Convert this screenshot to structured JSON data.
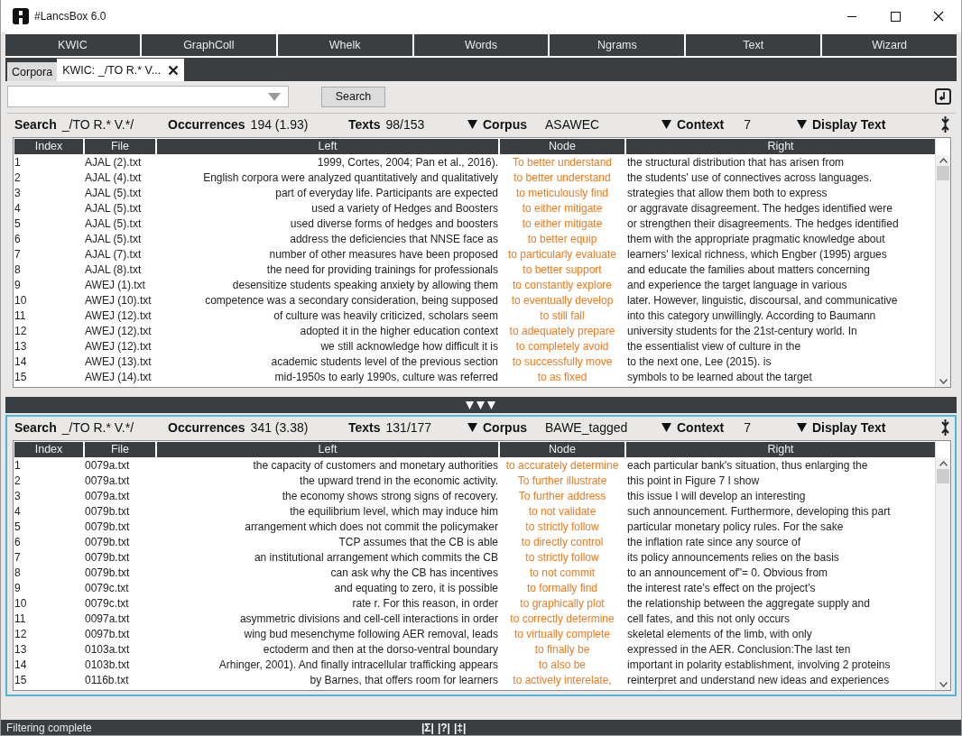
{
  "window": {
    "title": "#LancsBox 6.0"
  },
  "modules": [
    {
      "label": "KWIC"
    },
    {
      "label": "GraphColl"
    },
    {
      "label": "Whelk"
    },
    {
      "label": "Words"
    },
    {
      "label": "Ngrams"
    },
    {
      "label": "Text"
    },
    {
      "label": "Wizard"
    }
  ],
  "doc_tabs": [
    {
      "label": "Corpora",
      "selected": false,
      "closable": false
    },
    {
      "label": "KWIC:  _/TO R.* V...",
      "selected": true,
      "closable": true
    }
  ],
  "search_bar": {
    "button": "Search"
  },
  "panels": [
    {
      "active": false,
      "search_label": "Search",
      "search": "_/TO R.* V.*/",
      "occurrences_label": "Occurrences",
      "occurrences": "194 (1.93)",
      "texts_label": "Texts",
      "texts": "98/153",
      "corpus_label": "Corpus",
      "corpus": "ASAWEC",
      "context_label": "Context",
      "context": "7",
      "display_label": "Display Text",
      "columns": [
        "Index",
        "File",
        "Left",
        "Node",
        "Right"
      ],
      "rows": [
        [
          "1",
          "AJAL (2).txt",
          "1999, Cortes, 2004; Pan et al., 2016).",
          "To better understand",
          "the structural distribution that has arisen from"
        ],
        [
          "2",
          "AJAL (4).txt",
          "English corpora were analyzed quantitatively and qualitatively",
          "to better understand",
          "the students' use of connectives across languages."
        ],
        [
          "3",
          "AJAL (5).txt",
          "part of everyday life. Participants are expected",
          "to meticulously find",
          "strategies that allow them both to express"
        ],
        [
          "4",
          "AJAL (5).txt",
          "used a variety of Hedges and Boosters",
          "to either mitigate",
          "or aggravate disagreement. The hedges identified were"
        ],
        [
          "5",
          "AJAL (5).txt",
          "used diverse forms of hedges and boosters",
          "to either mitigate",
          "or strengthen their disagreements. The hedges identified"
        ],
        [
          "6",
          "AJAL (5).txt",
          "address the deficiencies that NNSE face as",
          "to better equip",
          "them with the appropriate pragmatic knowledge about"
        ],
        [
          "7",
          "AJAL (7).txt",
          "number of other measures have been proposed",
          "to particularly evaluate",
          "learners' lexical richness, which Engber (1995) argues"
        ],
        [
          "8",
          "AJAL (8).txt",
          "the need for providing trainings for professionals",
          "to better support",
          "and educate the families about matters concerning"
        ],
        [
          "9",
          "AWEJ (1).txt",
          "desensitize students speaking anxiety by allowing them",
          "to constantly explore",
          "and experience the target language in various"
        ],
        [
          "10",
          "AWEJ (10).txt",
          "competence was a secondary consideration, being supposed",
          "to eventually develop",
          "later. However, linguistic, discoursal, and communicative"
        ],
        [
          "11",
          "AWEJ (12).txt",
          "of culture was heavily criticized, scholars seem",
          "to still fall",
          "into this category unwillingly. According to Baumann"
        ],
        [
          "12",
          "AWEJ (12).txt",
          "adopted it in the higher education context",
          "to adequately prepare",
          "university students for the 21st-century world. In"
        ],
        [
          "13",
          "AWEJ (12).txt",
          "we still acknowledge how difficult it is",
          "to completely avoid",
          "the essentialist view of culture in the"
        ],
        [
          "14",
          "AWEJ (13).txt",
          "academic students level of the previous section",
          "to successfully move",
          "to the next one, Lee (2015). is"
        ],
        [
          "15",
          "AWEJ (14).txt",
          "mid-1950s to early 1990s, culture was referred",
          "to as fixed",
          "symbols to be learned about the target"
        ]
      ]
    },
    {
      "active": true,
      "search_label": "Search",
      "search": "_/TO R.* V.*/",
      "occurrences_label": "Occurrences",
      "occurrences": "341 (3.38)",
      "texts_label": "Texts",
      "texts": "131/177",
      "corpus_label": "Corpus",
      "corpus": "BAWE_tagged",
      "context_label": "Context",
      "context": "7",
      "display_label": "Display Text",
      "columns": [
        "Index",
        "File",
        "Left",
        "Node",
        "Right"
      ],
      "rows": [
        [
          "1",
          "0079a.txt",
          "the capacity of customers and monetary authorities",
          "to accurately determine",
          "each particular bank's situation, thus enlarging the"
        ],
        [
          "2",
          "0079a.txt",
          "the upward trend in the economic activity.",
          "To further illustrate",
          "this point in Figure 7 I show"
        ],
        [
          "3",
          "0079a.txt",
          "the economy shows strong signs of recovery.",
          "To further address",
          "this issue I will develop an interesting"
        ],
        [
          "4",
          "0079b.txt",
          "the equilibrium level, which may induce him",
          "to not validate",
          "such announcement. Furthermore, developing this part"
        ],
        [
          "5",
          "0079b.txt",
          "arrangement which does not commit the policymaker",
          "to strictly follow",
          "particular monetary policy rules. For the sake"
        ],
        [
          "6",
          "0079b.txt",
          "TCP assumes that the CB is able",
          "to directly control",
          "the inflation rate since any source of"
        ],
        [
          "7",
          "0079b.txt",
          "an institutional arrangement which commits the CB",
          "to strictly follow",
          "its policy announcements relies on the basis"
        ],
        [
          "8",
          "0079b.txt",
          "can ask why the CB has incentives",
          "to not commit",
          "to an announcement of\"= 0. Obvious from"
        ],
        [
          "9",
          "0079c.txt",
          "and equating to zero, it is possible",
          "to formally find",
          "the interest rate's effect on the project's"
        ],
        [
          "10",
          "0079c.txt",
          "rate r. For this reason, in order",
          "to graphically plot",
          "the relationship between the aggregate supply and"
        ],
        [
          "11",
          "0097a.txt",
          "asymmetric divisions and cell-cell interactions in order",
          "to correctly determine",
          "cell fates, and this not only occurs"
        ],
        [
          "12",
          "0097b.txt",
          "wing bud mesenchyme following AER removal, leads",
          "to virtually complete",
          "skeletal elements of the limb, with only"
        ],
        [
          "13",
          "0103a.txt",
          "ectoderm and then at the dorso-ventral boundary",
          "to finally be",
          "expressed in the AER. Conclusion:The last ten"
        ],
        [
          "14",
          "0103b.txt",
          "Arhinger, 2001). And finally intracellular trafficking appears",
          "to also be",
          "important in polarity establishment, involving 2 proteins"
        ],
        [
          "15",
          "0116b.txt",
          "by Barnes, that offers room for learners",
          "to actively interelate,",
          "reinterpret and understand new ideas and experiences"
        ]
      ]
    }
  ],
  "status_bar": {
    "message": "Filtering complete",
    "tools": [
      "|Σ|",
      "|?|",
      "|‡|"
    ]
  }
}
